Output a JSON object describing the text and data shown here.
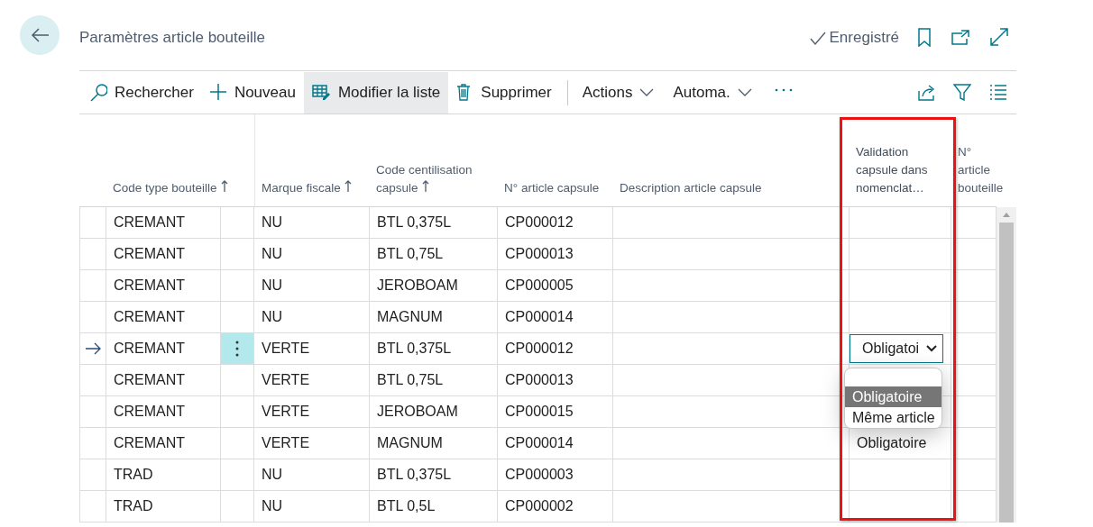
{
  "page": {
    "title": "Paramètres article bouteille",
    "status": "Enregistré"
  },
  "toolbar": {
    "actions": [
      {
        "kind": "search",
        "label": "Rechercher",
        "selected": false
      },
      {
        "kind": "new",
        "label": "Nouveau",
        "selected": false
      },
      {
        "kind": "edit",
        "label": "Modifier la liste",
        "selected": true
      },
      {
        "kind": "delete",
        "label": "Supprimer",
        "selected": false
      }
    ],
    "menus": [
      {
        "label": "Actions"
      },
      {
        "label": "Automa."
      }
    ]
  },
  "table": {
    "columns": [
      {
        "label": "Code type bouteille",
        "sorted": true,
        "highlighted": false
      },
      {
        "label": "Marque fiscale",
        "sorted": true,
        "highlighted": false
      },
      {
        "label": "Code centilisation capsule",
        "sorted": true,
        "highlighted": false
      },
      {
        "label": "N° article capsule",
        "sorted": false,
        "highlighted": false
      },
      {
        "label": "Description article capsule",
        "sorted": false,
        "highlighted": false
      },
      {
        "label": "Validation capsule dans nomenclat…",
        "sorted": false,
        "highlighted": true
      },
      {
        "label": "N° article bouteille",
        "sorted": false,
        "highlighted": false
      }
    ],
    "rows": [
      {
        "cells": [
          "CREMANT",
          "NU",
          "BTL 0,375L",
          "CP000012"
        ],
        "current": false
      },
      {
        "cells": [
          "CREMANT",
          "NU",
          "BTL 0,75L",
          "CP000013"
        ],
        "current": false
      },
      {
        "cells": [
          "CREMANT",
          "NU",
          "JEROBOAM",
          "CP000005"
        ],
        "current": false
      },
      {
        "cells": [
          "CREMANT",
          "NU",
          "MAGNUM",
          "CP000014"
        ],
        "current": false
      },
      {
        "cells": [
          "CREMANT",
          "VERTE",
          "BTL 0,375L",
          "CP000012"
        ],
        "current": true,
        "editor": {
          "value": "Obligatoi",
          "options": [
            {
              "label": "Obligatoire",
              "selected": true
            },
            {
              "label": "Même article",
              "selected": false
            }
          ]
        }
      },
      {
        "cells": [
          "CREMANT",
          "VERTE",
          "BTL 0,75L",
          "CP000013"
        ],
        "current": false
      },
      {
        "cells": [
          "CREMANT",
          "VERTE",
          "JEROBOAM",
          "CP000015"
        ],
        "current": false
      },
      {
        "cells": [
          "CREMANT",
          "VERTE",
          "MAGNUM",
          "CP000014"
        ],
        "current": false,
        "validation": "Obligatoire"
      },
      {
        "cells": [
          "TRAD",
          "NU",
          "BTL 0,375L",
          "CP000003"
        ],
        "current": false
      },
      {
        "cells": [
          "TRAD",
          "NU",
          "BTL 0,5L",
          "CP000002"
        ],
        "current": false
      }
    ]
  }
}
